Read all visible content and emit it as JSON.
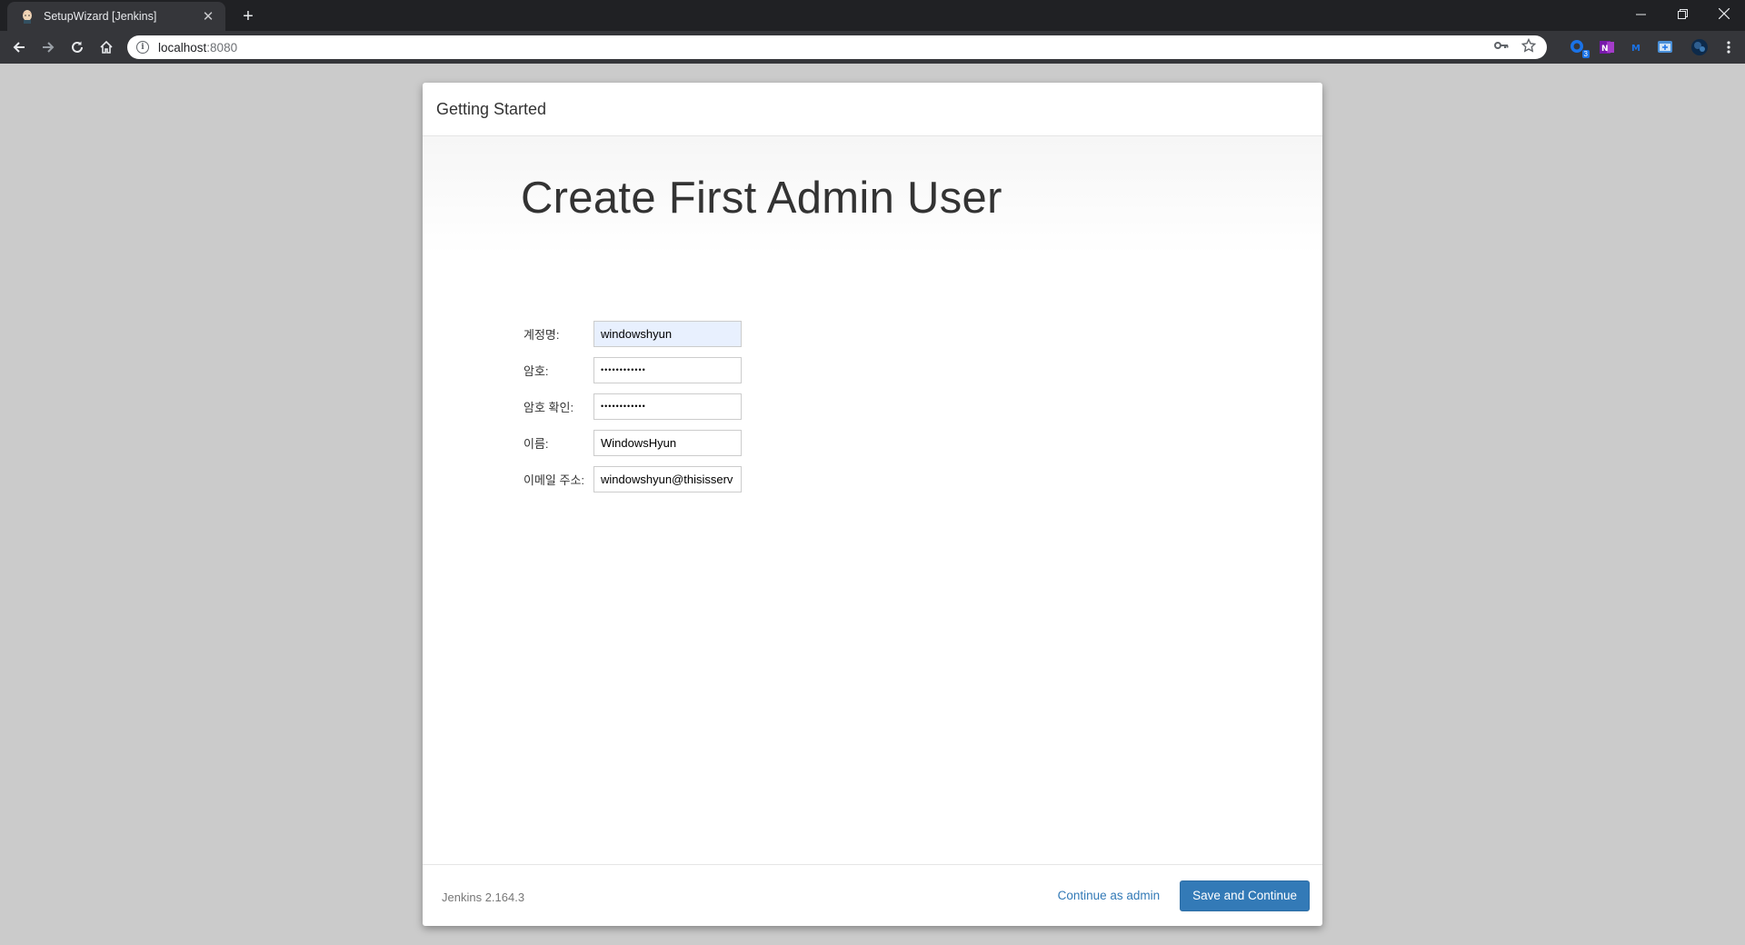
{
  "browser": {
    "tab_title": "SetupWizard [Jenkins]",
    "url_host": "localhost",
    "url_port": ":8080",
    "extension_badge": "3"
  },
  "dialog": {
    "header_title": "Getting Started",
    "page_title": "Create First Admin User",
    "fields": [
      {
        "label": "계정명:",
        "value": "windowshyun"
      },
      {
        "label": "암호:",
        "value": "••••••••••••"
      },
      {
        "label": "암호 확인:",
        "value": "••••••••••••"
      },
      {
        "label": "이름:",
        "value": "WindowsHyun"
      },
      {
        "label": "이메일 주소:",
        "value": "windowshyun@thisisserv"
      }
    ],
    "version": "Jenkins 2.164.3",
    "continue_as_admin": "Continue as admin",
    "save_and_continue": "Save and Continue"
  },
  "colors": {
    "primary": "#337ab7",
    "autofill": "#e8f0fe"
  }
}
